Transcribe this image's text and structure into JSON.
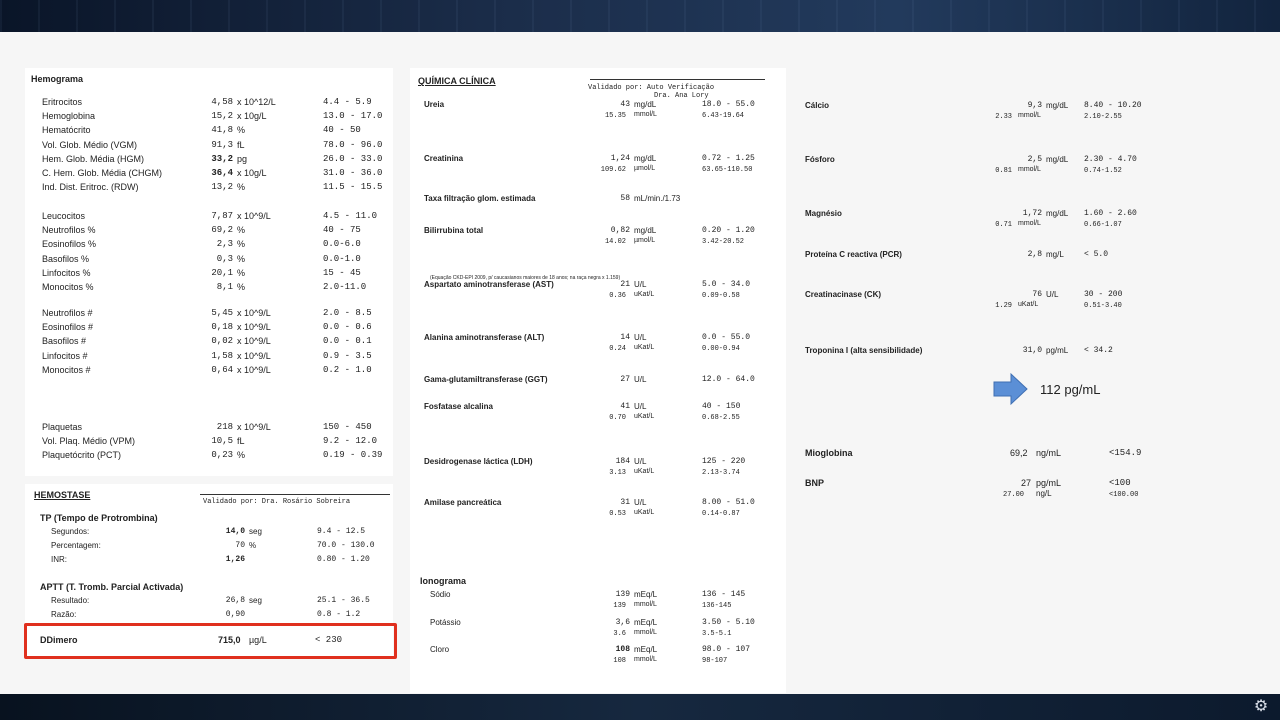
{
  "hemograma": {
    "title": "Hemograma",
    "groups": [
      [
        {
          "name": "Eritrocitos",
          "value": "4,58",
          "unit": "x 10^12/L",
          "ref": "4.4 - 5.9"
        },
        {
          "name": "Hemoglobina",
          "value": "15,2",
          "unit": "x 10g/L",
          "ref": "13.0 - 17.0"
        },
        {
          "name": "Hematócrito",
          "value": "41,8",
          "unit": "%",
          "ref": "40 - 50"
        },
        {
          "name": "Vol. Glob. Médio (VGM)",
          "value": "91,3",
          "unit": "fL",
          "ref": "78.0 - 96.0"
        },
        {
          "name": "Hem. Glob. Média (HGM)",
          "value": "33,2",
          "unit": "pg",
          "ref": "26.0 - 33.0"
        },
        {
          "name": "C. Hem. Glob. Média (CHGM)",
          "value": "36,4",
          "unit": "x 10g/L",
          "ref": "31.0 - 36.0"
        },
        {
          "name": "Ind. Dist. Eritroc. (RDW)",
          "value": "13,2",
          "unit": "%",
          "ref": "11.5 - 15.5"
        }
      ],
      [
        {
          "name": "Leucocitos",
          "value": "7,87",
          "unit": "x 10^9/L",
          "ref": "4.5 - 11.0"
        },
        {
          "name": "Neutrofilos %",
          "value": "69,2",
          "unit": "%",
          "ref": "40 - 75"
        },
        {
          "name": "Eosinofilos %",
          "value": "2,3",
          "unit": "%",
          "ref": "0.0-6.0"
        },
        {
          "name": "Basofilos   %",
          "value": "0,3",
          "unit": "%",
          "ref": "0.0-1.0"
        },
        {
          "name": "Linfocitos  %",
          "value": "20,1",
          "unit": "%",
          "ref": "15 - 45"
        },
        {
          "name": "Monocitos   %",
          "value": "8,1",
          "unit": "%",
          "ref": "2.0-11.0"
        }
      ],
      [
        {
          "name": "Neutrofilos #",
          "value": "5,45",
          "unit": "x 10^9/L",
          "ref": "2.0 - 8.5"
        },
        {
          "name": "Eosinofilos #",
          "value": "0,18",
          "unit": "x 10^9/L",
          "ref": "0.0 - 0.6"
        },
        {
          "name": "Basofilos   #",
          "value": "0,02",
          "unit": "x 10^9/L",
          "ref": "0.0 - 0.1"
        },
        {
          "name": "Linfocitos  #",
          "value": "1,58",
          "unit": "x 10^9/L",
          "ref": "0.9 - 3.5"
        },
        {
          "name": "Monocitos   #",
          "value": "0,64",
          "unit": "x 10^9/L",
          "ref": "0.2 - 1.0"
        }
      ],
      [
        {
          "name": "Plaquetas",
          "value": "218",
          "unit": "x 10^9/L",
          "ref": "150 - 450"
        },
        {
          "name": "Vol. Plaq. Médio (VPM)",
          "value": "10,5",
          "unit": "fL",
          "ref": "9.2 - 12.0"
        },
        {
          "name": "Plaquetócrito (PCT)",
          "value": "0,23",
          "unit": "%",
          "ref": "0.19 - 0.39"
        }
      ]
    ]
  },
  "hemostase": {
    "title": "HEMOSTASE",
    "validated": "Validado por:  Dra. Rosário Sobreira",
    "tp_title": "TP (Tempo de Protrombina)",
    "tp_rows": [
      {
        "name": "Segundos:",
        "value": "14,0",
        "unit": "seg",
        "ref": "9.4 - 12.5"
      },
      {
        "name": "Percentagem:",
        "value": "70",
        "unit": "%",
        "ref": "70.0 - 130.0"
      },
      {
        "name": "INR:",
        "value": "1,26",
        "unit": "",
        "ref": "0.80 - 1.20"
      }
    ],
    "aptt_title": "APTT (T. Tromb. Parcial Activada)",
    "aptt_rows": [
      {
        "name": "Resultado:",
        "value": "26,8",
        "unit": "seg",
        "ref": "25.1 - 36.5"
      },
      {
        "name": "Razão:",
        "value": "0,90",
        "unit": "",
        "ref": "0.8 - 1.2"
      }
    ],
    "ddimero": {
      "name": "DDimero",
      "value": "715,0",
      "unit": "µg/L",
      "ref": "< 230"
    }
  },
  "quimica": {
    "title": "QUÍMICA CLÍNICA",
    "validated": "Validado por:  Auto Verificação",
    "validated2": "Dra. Ana Lory",
    "tfg_note": "(Equação CKD-EPI 2009, p/ caucasianos maiores de 18 anos; na raça negra x 1.159)",
    "rows": [
      {
        "name": "Ureia",
        "value": "43",
        "unit": "mg/dL",
        "ref": "18.0 - 55.0",
        "sub_value": "15.35",
        "sub_unit": "mmol/L",
        "sub_ref": "6.43-19.64"
      },
      {
        "name": "Creatinina",
        "value": "1,24",
        "unit": "mg/dL",
        "ref": "0.72 - 1.25",
        "sub_value": "109.62",
        "sub_unit": "µmol/L",
        "sub_ref": "63.65-110.50"
      },
      {
        "name": "Taxa filtração glom. estimada",
        "value": "58",
        "unit": "mL/min./1.73",
        "ref": "",
        "sub_value": "",
        "sub_unit": "",
        "sub_ref": ""
      },
      {
        "name": "Bilirrubina total",
        "value": "0,82",
        "unit": "mg/dL",
        "ref": "0.20 - 1.20",
        "sub_value": "14.02",
        "sub_unit": "µmol/L",
        "sub_ref": "3.42-20.52"
      },
      {
        "name": "Aspartato aminotransferase (AST)",
        "value": "21",
        "unit": "U/L",
        "ref": "5.0 - 34.0",
        "sub_value": "0.36",
        "sub_unit": "uKat/L",
        "sub_ref": "0.09-0.58"
      },
      {
        "name": "Alanina aminotransferase (ALT)",
        "value": "14",
        "unit": "U/L",
        "ref": "0.0 - 55.0",
        "sub_value": "0.24",
        "sub_unit": "uKat/L",
        "sub_ref": "0.00-0.94"
      },
      {
        "name": "Gama-glutamiltransferase (GGT)",
        "value": "27",
        "unit": "U/L",
        "ref": "12.0 - 64.0",
        "sub_value": "",
        "sub_unit": "",
        "sub_ref": ""
      },
      {
        "name": "Fosfatase alcalina",
        "value": "41",
        "unit": "U/L",
        "ref": "40 - 150",
        "sub_value": "0.70",
        "sub_unit": "uKat/L",
        "sub_ref": "0.68-2.55"
      },
      {
        "name": "Desidrogenase láctica (LDH)",
        "value": "184",
        "unit": "U/L",
        "ref": "125 - 220",
        "sub_value": "3.13",
        "sub_unit": "uKat/L",
        "sub_ref": "2.13-3.74"
      },
      {
        "name": "Amilase pancreática",
        "value": "31",
        "unit": "U/L",
        "ref": "8.00 - 51.0",
        "sub_value": "0.53",
        "sub_unit": "uKat/L",
        "sub_ref": "0.14-0.87"
      }
    ],
    "ionograma": {
      "title": "Ionograma",
      "rows": [
        {
          "name": "Sódio",
          "value": "139",
          "unit": "mEq/L",
          "ref": "136 - 145",
          "sub_value": "139",
          "sub_unit": "mmol/L",
          "sub_ref": "136-145"
        },
        {
          "name": "Potássio",
          "value": "3,6",
          "unit": "mEq/L",
          "ref": "3.50 - 5.10",
          "sub_value": "3.6",
          "sub_unit": "mmol/L",
          "sub_ref": "3.5-5.1"
        },
        {
          "name": "Cloro",
          "value": "108",
          "unit": "mEq/L",
          "ref": "98.0 - 107",
          "sub_value": "108",
          "sub_unit": "mmol/L",
          "sub_ref": "98-107"
        }
      ]
    }
  },
  "right": {
    "rows": [
      {
        "name": "Cálcio",
        "value": "9,3",
        "unit": "mg/dL",
        "ref": "8.40 - 10.20",
        "sub_value": "2.33",
        "sub_unit": "mmol/L",
        "sub_ref": "2.10-2.55"
      },
      {
        "name": "Fósforo",
        "value": "2,5",
        "unit": "mg/dL",
        "ref": "2.30 - 4.70",
        "sub_value": "0.81",
        "sub_unit": "mmol/L",
        "sub_ref": "0.74-1.52"
      },
      {
        "name": "Magnésio",
        "value": "1,72",
        "unit": "mg/dL",
        "ref": "1.60 - 2.60",
        "sub_value": "0.71",
        "sub_unit": "mmol/L",
        "sub_ref": "0.66-1.07"
      },
      {
        "name": "Proteína C reactiva (PCR)",
        "value": "2,8",
        "unit": "mg/L",
        "ref": "< 5.0",
        "sub_value": "",
        "sub_unit": "",
        "sub_ref": ""
      },
      {
        "name": "Creatinacinase (CK)",
        "value": "76",
        "unit": "U/L",
        "ref": "30 - 200",
        "sub_value": "1.29",
        "sub_unit": "uKat/L",
        "sub_ref": "0.51-3.40"
      },
      {
        "name": "Troponina I (alta sensibilidade)",
        "value": "31,0",
        "unit": "pg/mL",
        "ref": "< 34.2",
        "sub_value": "",
        "sub_unit": "",
        "sub_ref": ""
      }
    ],
    "annotation": "112 pg/mL",
    "mioglobina": {
      "name": "Mioglobina",
      "value": "69,2",
      "unit": "ng/mL",
      "ref": "<154.9"
    },
    "bnp": {
      "name": "BNP",
      "value": "27",
      "unit": "pg/mL",
      "ref": "<100",
      "sub_value": "27.00",
      "sub_unit": "ng/L",
      "sub_ref": "<100.00"
    }
  },
  "colors": {
    "highlight": "#e0301e",
    "arrow": "#5b8fd6"
  },
  "icons": {
    "corner": "settings-gear-icon"
  }
}
